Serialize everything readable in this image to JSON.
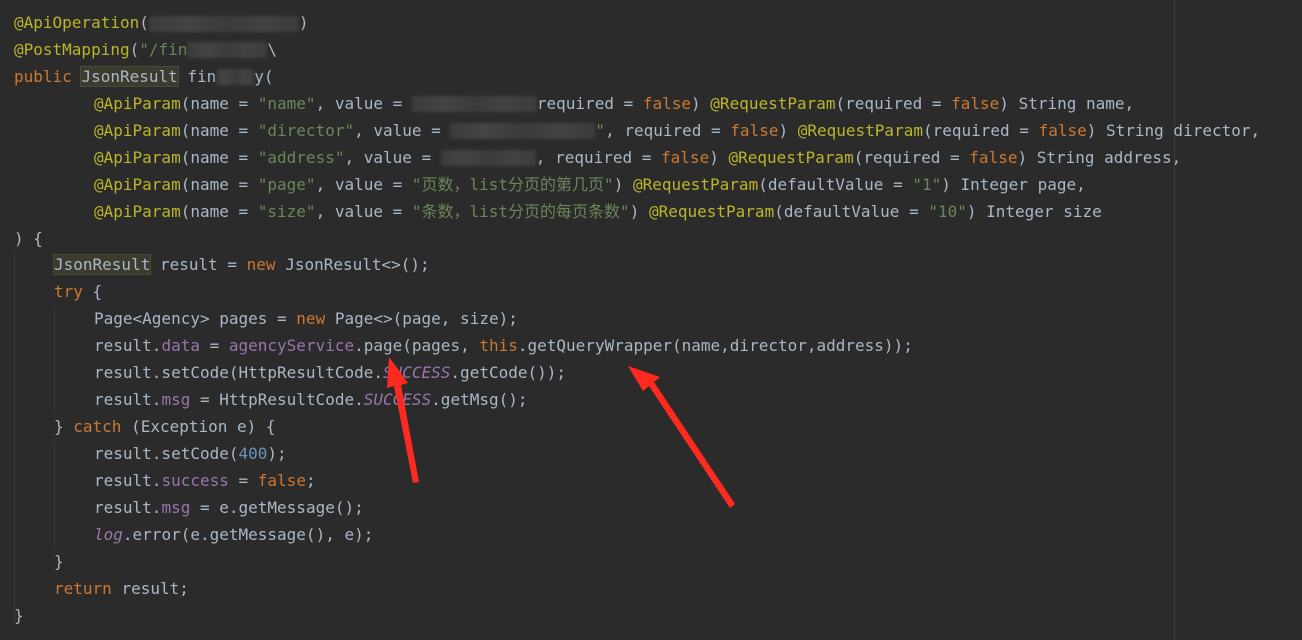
{
  "editor": {
    "language": "java",
    "theme_background": "#2b2b2b",
    "lines": [
      {
        "tokens": [
          [
            "ann",
            "@ApiOperation"
          ],
          [
            "plain",
            "("
          ]
        ],
        "masked_tail": ")"
      },
      {
        "tokens": [
          [
            "ann",
            "@PostMapping"
          ],
          [
            "plain",
            "("
          ],
          [
            "str",
            "\"/fin"
          ]
        ],
        "masked_tail": "\\"
      },
      {
        "tokens": [
          [
            "kw",
            "public "
          ],
          [
            "hl",
            "JsonResult"
          ],
          [
            "plain",
            " fin"
          ]
        ],
        "masked_tail": "y("
      },
      {
        "tokens": [
          [
            "ann",
            "@ApiParam"
          ],
          [
            "plain",
            "(name = "
          ],
          [
            "str",
            "\"name\""
          ],
          [
            "plain",
            ", value = "
          ]
        ],
        "tail": [
          [
            "plain",
            "required = "
          ],
          [
            "kw",
            "false"
          ],
          [
            "plain",
            ") "
          ],
          [
            "ann",
            "@RequestParam"
          ],
          [
            "plain",
            "(required = "
          ],
          [
            "kw",
            "false"
          ],
          [
            "plain",
            ") String name,"
          ]
        ]
      },
      {
        "tokens": [
          [
            "ann",
            "@ApiParam"
          ],
          [
            "plain",
            "(name = "
          ],
          [
            "str",
            "\"director\""
          ],
          [
            "plain",
            ", value = "
          ]
        ],
        "tail": [
          [
            "str",
            "\""
          ],
          [
            "plain",
            ", required = "
          ],
          [
            "kw",
            "false"
          ],
          [
            "plain",
            ") "
          ],
          [
            "ann",
            "@RequestParam"
          ],
          [
            "plain",
            "(required = "
          ],
          [
            "kw",
            "false"
          ],
          [
            "plain",
            ") String director,"
          ]
        ]
      },
      {
        "tokens": [
          [
            "ann",
            "@ApiParam"
          ],
          [
            "plain",
            "(name = "
          ],
          [
            "str",
            "\"address\""
          ],
          [
            "plain",
            ", value = "
          ]
        ],
        "tail": [
          [
            "plain",
            ", required = "
          ],
          [
            "kw",
            "false"
          ],
          [
            "plain",
            ") "
          ],
          [
            "ann",
            "@RequestParam"
          ],
          [
            "plain",
            "(required = "
          ],
          [
            "kw",
            "false"
          ],
          [
            "plain",
            ") String address,"
          ]
        ]
      },
      {
        "tokens": [
          [
            "ann",
            "@ApiParam"
          ],
          [
            "plain",
            "(name = "
          ],
          [
            "str",
            "\"page\""
          ],
          [
            "plain",
            ", value = "
          ],
          [
            "str",
            "\"页数，list分页的第几页\""
          ],
          [
            "plain",
            ") "
          ],
          [
            "ann",
            "@RequestParam"
          ],
          [
            "plain",
            "(defaultValue = "
          ],
          [
            "str",
            "\"1\""
          ],
          [
            "plain",
            ") Integer page,"
          ]
        ]
      },
      {
        "tokens": [
          [
            "ann",
            "@ApiParam"
          ],
          [
            "plain",
            "(name = "
          ],
          [
            "str",
            "\"size\""
          ],
          [
            "plain",
            ", value = "
          ],
          [
            "str",
            "\"条数，list分页的每页条数\""
          ],
          [
            "plain",
            ") "
          ],
          [
            "ann",
            "@RequestParam"
          ],
          [
            "plain",
            "(defaultValue = "
          ],
          [
            "str",
            "\"10\""
          ],
          [
            "plain",
            ") Integer size"
          ]
        ]
      },
      {
        "tokens": [
          [
            "plain",
            ") {"
          ]
        ]
      },
      {
        "tokens": [
          [
            "hl",
            "JsonResult"
          ],
          [
            "plain",
            " result = "
          ],
          [
            "kw",
            "new "
          ],
          [
            "plain",
            "JsonResult<>();"
          ]
        ]
      },
      {
        "tokens": [
          [
            "kw",
            "try "
          ],
          [
            "plain",
            "{"
          ]
        ]
      },
      {
        "tokens": [
          [
            "plain",
            "Page<Agency> pages = "
          ],
          [
            "kw",
            "new "
          ],
          [
            "plain",
            "Page<>(page, size);"
          ]
        ]
      },
      {
        "tokens": [
          [
            "plain",
            "result."
          ],
          [
            "fld",
            "data"
          ],
          [
            "plain",
            " = "
          ],
          [
            "fld",
            "agencyService"
          ],
          [
            "plain",
            ".page(pages, "
          ],
          [
            "kw",
            "this"
          ],
          [
            "plain",
            ".getQueryWrapper(name,director,address));"
          ]
        ]
      },
      {
        "tokens": [
          [
            "plain",
            "result.setCode(HttpResultCode."
          ],
          [
            "fldi",
            "SUCCESS"
          ],
          [
            "plain",
            ".getCode());"
          ]
        ]
      },
      {
        "tokens": [
          [
            "plain",
            "result."
          ],
          [
            "fld",
            "msg"
          ],
          [
            "plain",
            " = HttpResultCode."
          ],
          [
            "fldi",
            "SUCCESS"
          ],
          [
            "plain",
            ".getMsg();"
          ]
        ]
      },
      {
        "tokens": [
          [
            "plain",
            "} "
          ],
          [
            "kw",
            "catch "
          ],
          [
            "plain",
            "(Exception e) {"
          ]
        ]
      },
      {
        "tokens": [
          [
            "plain",
            "result.setCode("
          ],
          [
            "num",
            "400"
          ],
          [
            "plain",
            ");"
          ]
        ]
      },
      {
        "tokens": [
          [
            "plain",
            "result."
          ],
          [
            "fld",
            "success"
          ],
          [
            "plain",
            " = "
          ],
          [
            "kw",
            "false"
          ],
          [
            "plain",
            ";"
          ]
        ]
      },
      {
        "tokens": [
          [
            "plain",
            "result."
          ],
          [
            "fld",
            "msg"
          ],
          [
            "plain",
            " = e.getMessage();"
          ]
        ]
      },
      {
        "tokens": [
          [
            "fldi",
            "log"
          ],
          [
            "plain",
            ".error(e.getMessage(), e);"
          ]
        ]
      },
      {
        "tokens": [
          [
            "plain",
            "}"
          ]
        ]
      },
      {
        "tokens": [
          [
            "kw",
            "return "
          ],
          [
            "plain",
            "result;"
          ]
        ]
      },
      {
        "tokens": [
          [
            "plain",
            "}"
          ]
        ]
      }
    ]
  },
  "annotations": {
    "arrow_color": "#ff2a1f",
    "arrow_count": 2
  }
}
